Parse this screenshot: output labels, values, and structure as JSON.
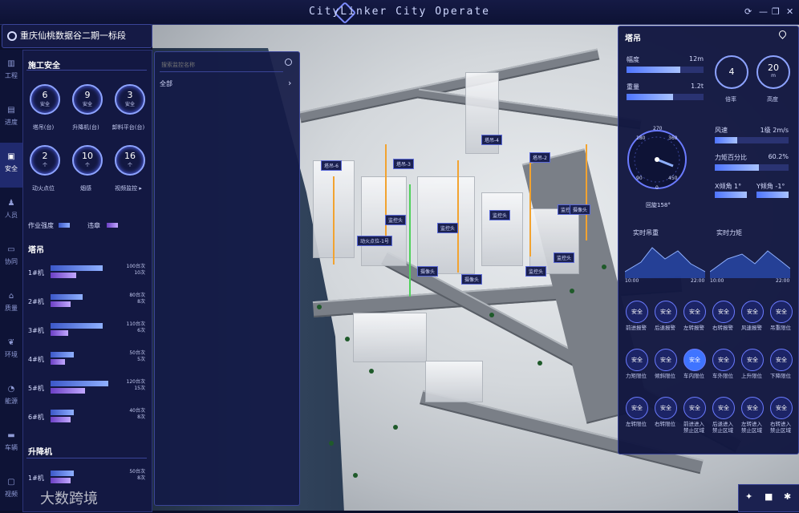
{
  "app": {
    "title": "CityLinker City Operate",
    "min": "—",
    "max": "❐",
    "close": "✕",
    "share": "⟳"
  },
  "project": {
    "title": "重庆仙桃数据谷二期一标段"
  },
  "nav": [
    {
      "label": "工程",
      "icon": "chart-icon"
    },
    {
      "label": "进度",
      "icon": "progress-icon"
    },
    {
      "label": "安全",
      "icon": "safety-icon"
    },
    {
      "label": "人员",
      "icon": "person-icon"
    },
    {
      "label": "协同",
      "icon": "doc-icon"
    },
    {
      "label": "质量",
      "icon": "quality-icon"
    },
    {
      "label": "环境",
      "icon": "leaf-icon"
    },
    {
      "label": "能源",
      "icon": "energy-icon"
    },
    {
      "label": "车辆",
      "icon": "car-icon"
    },
    {
      "label": "视频",
      "icon": "video-icon"
    }
  ],
  "left": {
    "title": "施工安全",
    "rings_row1": [
      {
        "num": "6",
        "unit": "安全",
        "label": "塔吊(台)"
      },
      {
        "num": "9",
        "unit": "安全",
        "label": "升降机(台)"
      },
      {
        "num": "3",
        "unit": "安全",
        "label": "卸料平台(台)"
      }
    ],
    "rings_row2": [
      {
        "num": "2",
        "unit": "个",
        "label": "动火点位"
      },
      {
        "num": "10",
        "unit": "个",
        "label": "烟感"
      },
      {
        "num": "16",
        "unit": "个",
        "label": "视频监控 ▸"
      }
    ],
    "legend": {
      "intensity": "作业强度",
      "violation": "违章"
    },
    "crane_title": "塔吊",
    "cranes": [
      {
        "name": "1#机",
        "count": "100台次",
        "viol": "10次",
        "a": 0.9,
        "b": 0.45
      },
      {
        "name": "2#机",
        "count": "80台次",
        "viol": "8次",
        "a": 0.55,
        "b": 0.35
      },
      {
        "name": "3#机",
        "count": "110台次",
        "viol": "6次",
        "a": 0.9,
        "b": 0.3
      },
      {
        "name": "4#机",
        "count": "50台次",
        "viol": "5次",
        "a": 0.4,
        "b": 0.25
      },
      {
        "name": "5#机",
        "count": "120台次",
        "viol": "15次",
        "a": 1.0,
        "b": 0.6
      },
      {
        "name": "6#机",
        "count": "40台次",
        "viol": "8次",
        "a": 0.4,
        "b": 0.35
      }
    ],
    "hoist_title": "升降机",
    "hoists": [
      {
        "name": "1#机",
        "count": "50台次",
        "viol": "8次",
        "a": 0.4,
        "b": 0.35
      }
    ]
  },
  "search": {
    "placeholder": "搜索监控名称",
    "all": "全部",
    "arrow": "›"
  },
  "right": {
    "title": "塔吊",
    "metrics": [
      {
        "label": "幅度",
        "value": "12m",
        "fill": 0.7
      },
      {
        "label": "重量",
        "value": "1.2t",
        "fill": 0.6
      }
    ],
    "circles": [
      {
        "num": "4",
        "unit": "",
        "label": "倍率"
      },
      {
        "num": "20",
        "unit": "m",
        "label": "高度"
      }
    ],
    "dial": {
      "t270": "270",
      "t180": "180",
      "t360": "360",
      "t90": "90",
      "t450": "450",
      "t0": "0",
      "caption": "回旋158°"
    },
    "stats": [
      {
        "label": "风速",
        "value": "1级 2m/s",
        "fill": 0.3
      },
      {
        "label": "力矩百分比",
        "value": "60.2%",
        "fill": 0.6
      }
    ],
    "tilt": {
      "x": "X倾角 1°",
      "y": "Y倾角 -1°"
    },
    "chart_titles": {
      "load": "实时吊重",
      "torque": "实时力矩"
    },
    "chart_ticks": {
      "a0": "10:00",
      "a1": "22:00",
      "b0": "10:00",
      "b1": "22:00"
    },
    "buttons": [
      {
        "state": "安全",
        "label": "前进报警",
        "on": false
      },
      {
        "state": "安全",
        "label": "后退报警",
        "on": false
      },
      {
        "state": "安全",
        "label": "左转报警",
        "on": false
      },
      {
        "state": "安全",
        "label": "右转报警",
        "on": false
      },
      {
        "state": "安全",
        "label": "风速报警",
        "on": false
      },
      {
        "state": "安全",
        "label": "吊重限位",
        "on": false
      },
      {
        "state": "安全",
        "label": "力矩限位",
        "on": false
      },
      {
        "state": "安全",
        "label": "倾斜限位",
        "on": false
      },
      {
        "state": "安全",
        "label": "车内限位",
        "on": true
      },
      {
        "state": "安全",
        "label": "车外限位",
        "on": false
      },
      {
        "state": "安全",
        "label": "上升限位",
        "on": false
      },
      {
        "state": "安全",
        "label": "下降限位",
        "on": false
      },
      {
        "state": "安全",
        "label": "左转限位",
        "on": false
      },
      {
        "state": "安全",
        "label": "右转限位",
        "on": false
      },
      {
        "state": "安全",
        "label": "前进进入\n禁止区域",
        "on": false
      },
      {
        "state": "安全",
        "label": "后退进入\n禁止区域",
        "on": false
      },
      {
        "state": "安全",
        "label": "左转进入\n禁止区域",
        "on": false
      },
      {
        "state": "安全",
        "label": "右转进入\n禁止区域",
        "on": false
      }
    ]
  },
  "map_tags": [
    "塔吊-6",
    "塔吊-3",
    "塔吊-4",
    "塔吊-2",
    "监控头",
    "监控头",
    "监控头",
    "监控头",
    "监控头",
    "监控头",
    "动火点位-1号",
    "摄像头",
    "摄像头",
    "摄像头"
  ],
  "watermark": "大数跨境"
}
